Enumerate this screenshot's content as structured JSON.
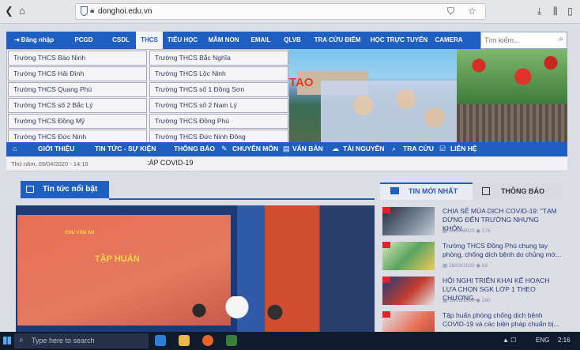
{
  "browser": {
    "url": "donghoi.edu.vn",
    "icons": [
      "back-icon",
      "home-icon",
      "shield-icon",
      "lock-icon",
      "reader-icon",
      "pocket-icon",
      "star-icon",
      "download-icon",
      "library-icon",
      "sidebar-icon",
      "menu-icon"
    ]
  },
  "topmenu": {
    "items": [
      "Đăng nhập",
      "PCGD",
      "CSDL",
      "THCS",
      "TIỂU HỌC",
      "MẦM NON",
      "EMAIL",
      "QLVB",
      "TRA CỨU ĐIỂM",
      "HỌC TRỰC TUYẾN",
      "CAMERA"
    ],
    "search_placeholder": "Tìm kiếm..."
  },
  "dropdown": {
    "left": [
      "Trường THCS Bảo Ninh",
      "Trường THCS Hải Đình",
      "Trường THCS Quang Phú",
      "Trường THCS số 2 Bắc Lý",
      "Trường THCS Đồng Mỹ",
      "Trường THCS Đức Ninh"
    ],
    "right": [
      "Trường THCS Bắc Nghĩa",
      "Trường THCS Lộc Ninh",
      "Trường THCS số 1 Đồng Sơn",
      "Trường THCS số 2 Nam Lý",
      "Trường THCS Đồng Phú",
      "Trường THCS Đức Ninh Đông"
    ]
  },
  "banner": {
    "text": "TAO"
  },
  "mainnav": {
    "items": [
      "GIỚI THIỆU",
      "TIN TỨC - SỰ KIỆN",
      "THÔNG BÁO",
      "CHUYÊN MÔN",
      "VĂN BẢN",
      "TÀI NGUYÊN",
      "TRA CỨU",
      "LIÊN HỆ"
    ]
  },
  "datebar": {
    "date": "Thứ năm, 09/04/2020 - 14:16",
    "ticker": ":ÁP COVID-19"
  },
  "featured": {
    "title": "Tin tức nổi bật",
    "screen_header": "CHU VĂN AN",
    "screen_big": "TẬP HUẤN"
  },
  "tabs": {
    "new": "TIN MỚI NHẤT",
    "notice": "THÔNG BÁO"
  },
  "news": [
    {
      "title": "CHIA SẺ MÙA DỊCH COVID-19: \"TẠM DỪNG ĐẾN TRƯỜNG NHƯNG KHÔN...",
      "date": "06/04/2020",
      "views": "276"
    },
    {
      "title": "Trường THCS Đồng Phú chung tay phòng, chống dịch bệnh do chủng mớ...",
      "date": "28/03/2020",
      "views": "83"
    },
    {
      "title": "HỘI NGHỊ TRIỂN KHAI KẾ HOẠCH LỰA CHỌN SGK LỚP 1 THEO CHƯƠNG...",
      "date": "18/03/2020",
      "views": "390"
    },
    {
      "title": "Tập huấn phòng chống dịch bệnh COVID-19 và các biện pháp chuẩn bị...",
      "date": "",
      "views": ""
    }
  ],
  "taskbar": {
    "search": "Type here to search",
    "lang": "ENG",
    "time": "2:16"
  },
  "colors": {
    "brand": "#1f5fc2",
    "alert": "#e0202a"
  }
}
